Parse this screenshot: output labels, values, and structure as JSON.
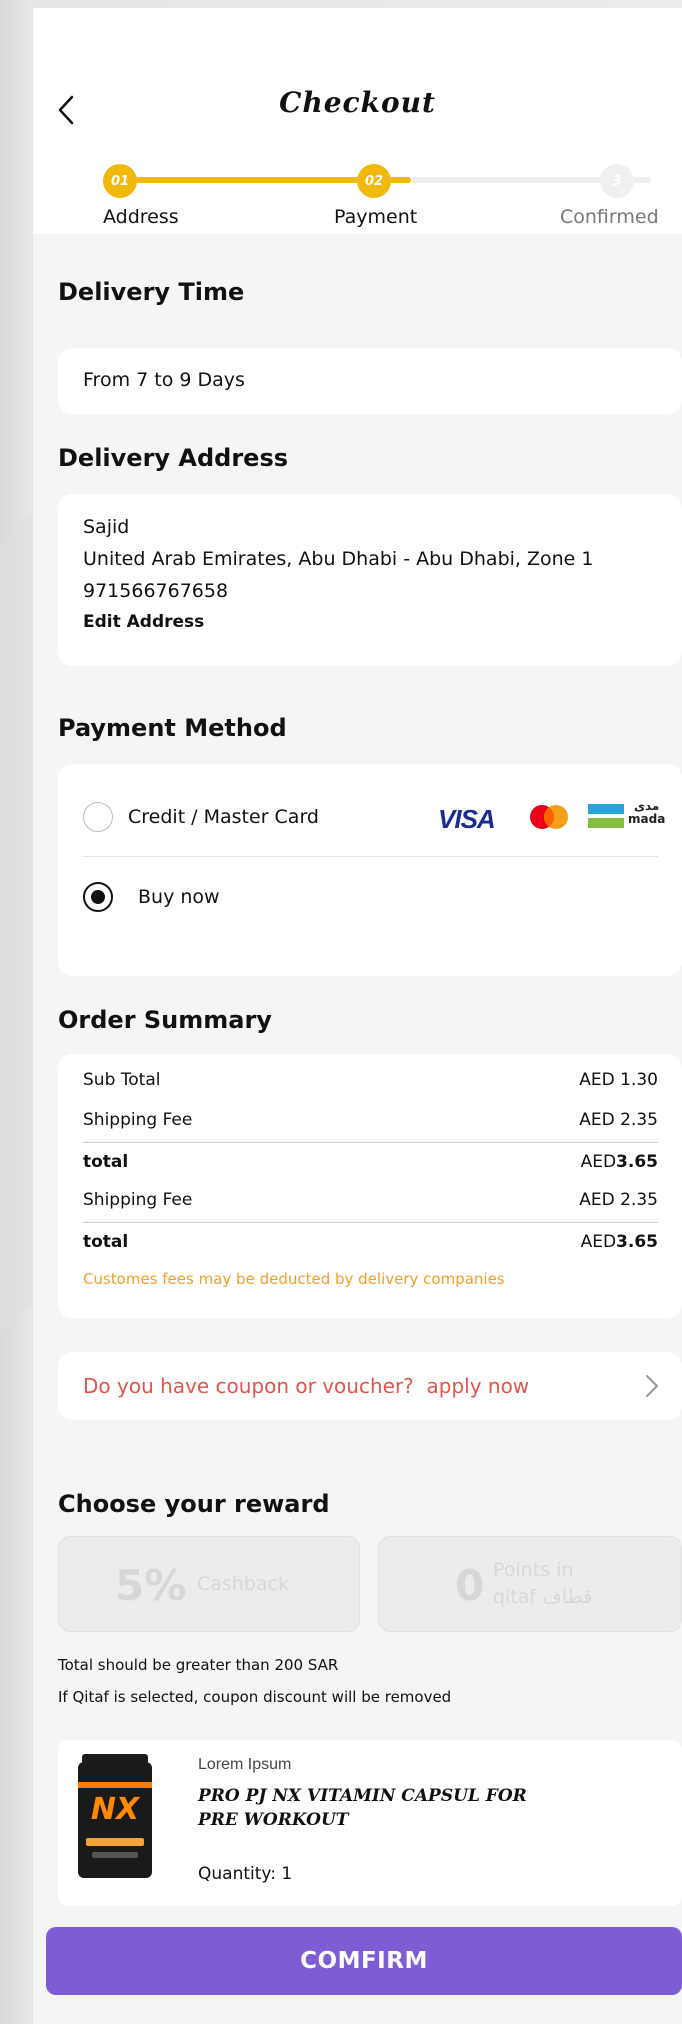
{
  "header": {
    "title": "Checkout"
  },
  "stepper": {
    "steps": [
      {
        "number": "01",
        "label": "Address"
      },
      {
        "number": "02",
        "label": "Payment"
      },
      {
        "number": "3",
        "label": "Confirmed"
      }
    ]
  },
  "delivery_time": {
    "title": "Delivery Time",
    "value": "From 7 to 9 Days"
  },
  "delivery_address": {
    "title": "Delivery Address",
    "name": "Sajid",
    "address": "United Arab Emirates, Abu Dhabi - Abu Dhabi, Zone 1",
    "phone": "971566767658",
    "edit_label": "Edit Address"
  },
  "payment_method": {
    "title": "Payment Method",
    "options": [
      {
        "label": "Credit / Master Card",
        "selected": false
      },
      {
        "label": "Buy now",
        "selected": true
      }
    ],
    "logos": {
      "visa": "VISA",
      "mada_ar": "مدى",
      "mada_en": "mada"
    }
  },
  "order_summary": {
    "title": "Order Summary",
    "rows": [
      {
        "label": "Sub Total",
        "currency": "AED",
        "amount": "1.30"
      },
      {
        "label": "Shipping Fee",
        "currency": "AED",
        "amount": "2.35"
      },
      {
        "label": "total",
        "currency": "AED",
        "amount": "3.65"
      },
      {
        "label": "Shipping Fee",
        "currency": "AED",
        "amount": "2.35"
      },
      {
        "label": "total",
        "currency": "AED",
        "amount": "3.65"
      }
    ],
    "note": "Customes fees may be deducted by delivery companies"
  },
  "coupon": {
    "text": "Do you have coupon or voucher?",
    "action": "apply now"
  },
  "reward": {
    "title": "Choose your reward",
    "cashback": {
      "value": "5%",
      "label": "Cashback"
    },
    "points": {
      "value": "0",
      "label_line1": "Points in",
      "label_line2": "qitaf",
      "label_ar": "قطاف"
    },
    "note1": "Total should be greater than 200 SAR",
    "note2": "If Qitaf is selected, coupon discount will be removed"
  },
  "product": {
    "brand": "Lorem Ipsum",
    "name_line1": "PRO PJ NX VITAMIN CAPSUL FOR",
    "name_line2": "PRE WORKOUT",
    "quantity": "Quantity: 1",
    "jar_label": "NX"
  },
  "confirm_label": "COMFIRM",
  "colors": {
    "accent_yellow": "#f0b90b",
    "purple": "#7d5cd4",
    "coupon_red": "#e2554c",
    "note_orange": "#f0a028"
  }
}
